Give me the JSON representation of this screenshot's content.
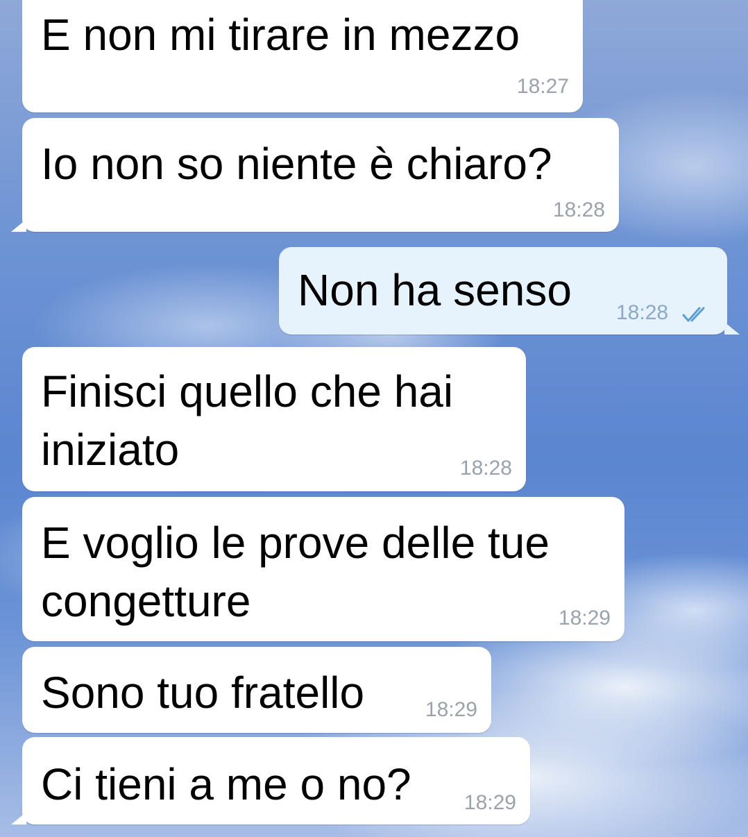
{
  "chat": {
    "messages": [
      {
        "text": "E non mi tirare in mezzo",
        "time": "18:27",
        "direction": "incoming"
      },
      {
        "text": "Io non so niente è chiaro?",
        "time": "18:28",
        "direction": "incoming"
      },
      {
        "text": "Non ha senso",
        "time": "18:28",
        "direction": "outgoing",
        "status_icon": "double-check-icon",
        "status_color": "#5a9fd4"
      },
      {
        "text_lines": [
          "Finisci quello che hai",
          "iniziato"
        ],
        "time": "18:28",
        "direction": "incoming"
      },
      {
        "text_lines": [
          "E voglio le prove delle tue",
          "congetture"
        ],
        "time": "18:29",
        "direction": "incoming"
      },
      {
        "text": "Sono tuo fratello",
        "time": "18:29",
        "direction": "incoming"
      },
      {
        "text": "Ci tieni a me o no?",
        "time": "18:29",
        "direction": "incoming"
      }
    ],
    "colors": {
      "incoming_bubble": "#ffffff",
      "outgoing_bubble": "#e6f2fc",
      "time_text": "#9aa3ad",
      "read_check": "#5a9fd4"
    }
  }
}
